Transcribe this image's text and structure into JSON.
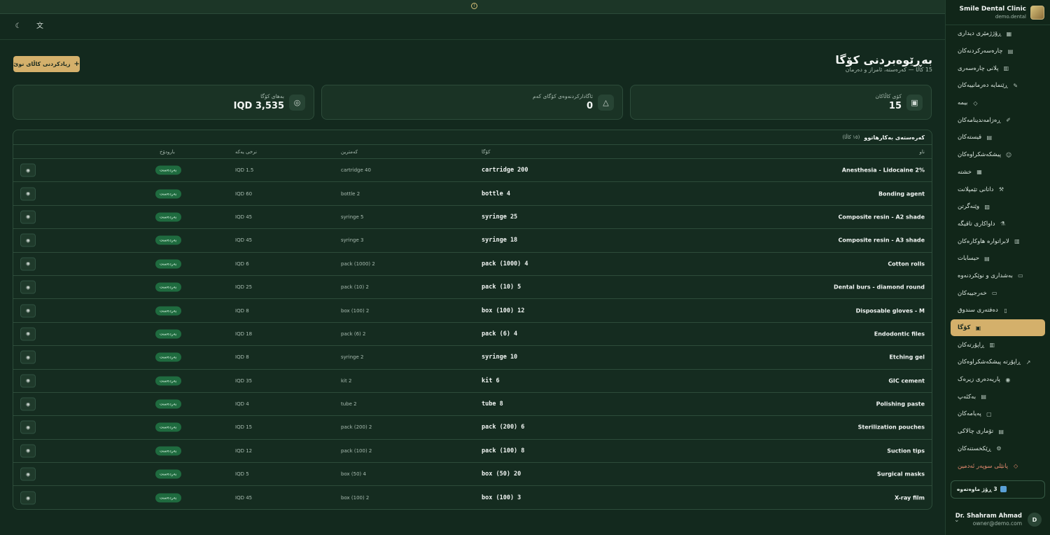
{
  "brand": {
    "name": "Smile Dental Clinic",
    "domain": "demo.dental"
  },
  "sidebar": {
    "items": [
      {
        "label": "ڕۆژژمێری دیداری",
        "icon": "calendar-icon",
        "active": false
      },
      {
        "label": "چارەسەرکردنەکان",
        "icon": "clipboard-icon",
        "active": false
      },
      {
        "label": "پلانی چارەسەری",
        "icon": "clipboard-list-icon",
        "active": false
      },
      {
        "label": "ڕێنمایە دەرمانییەکان",
        "icon": "pill-icon",
        "active": false
      },
      {
        "label": "بیمە",
        "icon": "shield-icon",
        "active": false
      },
      {
        "label": "ڕەزامەندینامەکان",
        "icon": "file-signature-icon",
        "active": false
      },
      {
        "label": "قیستەکان",
        "icon": "receipt-icon",
        "active": false
      },
      {
        "label": "پیشکەشکراوەکان",
        "icon": "user-check-icon",
        "active": false
      },
      {
        "label": "خشتە",
        "icon": "calendar-grid-icon",
        "active": false
      },
      {
        "label": "داتانی تێمپلانت",
        "icon": "wrench-icon",
        "active": false
      },
      {
        "label": "وێنەگرتن",
        "icon": "image-icon",
        "active": false
      },
      {
        "label": "داواکاری تاقیگە",
        "icon": "flask-icon",
        "active": false
      },
      {
        "label": "لابراتوارە هاوکارەکان",
        "icon": "building-icon",
        "active": false
      },
      {
        "label": "حیسابات",
        "icon": "calculator-icon",
        "active": false
      },
      {
        "label": "بەشداری و نوێکردنەوە",
        "icon": "credit-card-icon",
        "active": false
      },
      {
        "label": "خەرجییەکان",
        "icon": "wallet-icon",
        "active": false
      },
      {
        "label": "دەفتەری سندوق",
        "icon": "book-icon",
        "active": false
      },
      {
        "label": "کۆگا",
        "icon": "box-icon",
        "active": true
      },
      {
        "label": "ڕاپۆرتەکان",
        "icon": "bar-chart-icon",
        "active": false
      },
      {
        "label": "ڕاپۆرتە پیشکەشکراوەکان",
        "icon": "trend-icon",
        "active": false
      },
      {
        "label": "پاریەدەری زیرەک",
        "icon": "bot-icon",
        "active": false
      },
      {
        "label": "بەکئەپ",
        "icon": "database-icon",
        "active": false
      },
      {
        "label": "پەیامەکان",
        "icon": "message-icon",
        "active": false
      },
      {
        "label": "تۆماری چالاکی",
        "icon": "log-icon",
        "active": false
      },
      {
        "label": "ڕێکخستنەکان",
        "icon": "gear-icon",
        "active": false
      },
      {
        "label": "پانێلی سوپەر ئەدمین",
        "icon": "shield-admin-icon",
        "active": false,
        "danger": true
      }
    ],
    "trial": "3 ڕۆژ ماوەتەوە",
    "user": {
      "name": "Dr. Shahram Ahmad",
      "email": "owner@demo.com",
      "initial": "D"
    }
  },
  "header": {
    "title": "بەڕێوەبردنی کۆگا",
    "subtitle": "15 کاڵا — کەرەستە، ئامراز و دەرمان",
    "add_button": "زیادکردنی کاڵای نوێ"
  },
  "stats": [
    {
      "label": "کۆی کاڵاکان",
      "value": "15",
      "icon": "box-icon"
    },
    {
      "label": "ئاگادارکردنەوەی کۆگای کەم",
      "value": "0",
      "icon": "warning-icon"
    },
    {
      "label": "بەهای کۆگا",
      "value": "IQD 3,535",
      "icon": "coins-icon"
    }
  ],
  "table": {
    "title": "کەرەستەی بەکارهاتوو",
    "count": "(١٥ کاڵا)",
    "columns": {
      "name": "ناو",
      "stock": "کۆگا",
      "min": "کەمترین",
      "price": "نرخی یەکە",
      "status": "بارودۆخ"
    },
    "rows": [
      {
        "name": "Anesthesia - Lidocaine 2%",
        "stock": "cartridge 200",
        "min": "cartridge 40",
        "price": "IQD 1.5",
        "status": "بەردەست"
      },
      {
        "name": "Bonding agent",
        "stock": "bottle 4",
        "min": "bottle 2",
        "price": "IQD 60",
        "status": "بەردەست"
      },
      {
        "name": "Composite resin - A2 shade",
        "stock": "syringe 25",
        "min": "syringe 5",
        "price": "IQD 45",
        "status": "بەردەست"
      },
      {
        "name": "Composite resin - A3 shade",
        "stock": "syringe 18",
        "min": "syringe 3",
        "price": "IQD 45",
        "status": "بەردەست"
      },
      {
        "name": "Cotton rolls",
        "stock": "pack (1000) 4",
        "min": "pack (1000) 2",
        "price": "IQD 6",
        "status": "بەردەست"
      },
      {
        "name": "Dental burs - diamond round",
        "stock": "pack (10) 5",
        "min": "pack (10) 2",
        "price": "IQD 25",
        "status": "بەردەست"
      },
      {
        "name": "Disposable gloves - M",
        "stock": "box (100) 12",
        "min": "box (100) 2",
        "price": "IQD 8",
        "status": "بەردەست"
      },
      {
        "name": "Endodontic files",
        "stock": "pack (6) 4",
        "min": "pack (6) 2",
        "price": "IQD 18",
        "status": "بەردەست"
      },
      {
        "name": "Etching gel",
        "stock": "syringe 10",
        "min": "syringe 2",
        "price": "IQD 8",
        "status": "بەردەست"
      },
      {
        "name": "GIC cement",
        "stock": "kit 6",
        "min": "kit 2",
        "price": "IQD 35",
        "status": "بەردەست"
      },
      {
        "name": "Polishing paste",
        "stock": "tube 8",
        "min": "tube 2",
        "price": "IQD 4",
        "status": "بەردەست"
      },
      {
        "name": "Sterilization pouches",
        "stock": "pack (200) 6",
        "min": "pack (200) 2",
        "price": "IQD 15",
        "status": "بەردەست"
      },
      {
        "name": "Suction tips",
        "stock": "pack (100) 8",
        "min": "pack (100) 2",
        "price": "IQD 12",
        "status": "بەردەست"
      },
      {
        "name": "Surgical masks",
        "stock": "box (50) 20",
        "min": "box (50) 4",
        "price": "IQD 5",
        "status": "بەردەست"
      },
      {
        "name": "X-ray film",
        "stock": "box (100) 3",
        "min": "box (100) 2",
        "price": "IQD 45",
        "status": "بەردەست"
      }
    ]
  },
  "colors": {
    "accent": "#d4b06b",
    "background": "#13291e",
    "status_ok": "#1f6b3f"
  }
}
